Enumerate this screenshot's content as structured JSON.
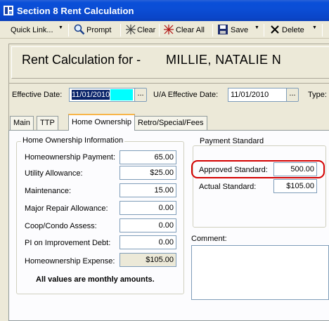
{
  "window": {
    "title": "Section 8 Rent Calculation",
    "icon": "app-icon"
  },
  "toolbar": {
    "quick_link": "Quick Link...",
    "prompt": "Prompt",
    "clear": "Clear",
    "clear_all": "Clear All",
    "save": "Save",
    "delete": "Delete"
  },
  "header": {
    "label": "Rent Calculation for  -",
    "tenant_name": "MILLIE, NATALIE N"
  },
  "dates": {
    "effective_label": "Effective Date:",
    "effective_value": "11/01/2010",
    "ua_label": "U/A Effective Date:",
    "ua_value": "11/01/2010",
    "type_label": "Type:",
    "browse": "..."
  },
  "tabs": [
    {
      "label": "Main"
    },
    {
      "label": "TTP"
    },
    {
      "label": "Home Ownership"
    },
    {
      "label": "Retro/Special/Fees"
    }
  ],
  "home_ownership": {
    "group_title": "Home Ownership Information",
    "rows": [
      {
        "label": "Homeownership Payment:",
        "value": "65.00"
      },
      {
        "label": "Utility Allowance:",
        "value": "$25.00"
      },
      {
        "label": "Maintenance:",
        "value": "15.00"
      },
      {
        "label": "Major Repair Allowance:",
        "value": "0.00"
      },
      {
        "label": "Coop/Condo Assess:",
        "value": "0.00"
      },
      {
        "label": "PI on Improvement Debt:",
        "value": "0.00"
      },
      {
        "label": "Homeownership Expense:",
        "value": "$105.00"
      }
    ],
    "note": "All values are monthly amounts."
  },
  "payment_standard": {
    "group_title": "Payment Standard",
    "approved_label": "Approved Standard:",
    "approved_value": "500.00",
    "actual_label": "Actual Standard:",
    "actual_value": "$105.00"
  },
  "comment": {
    "label": "Comment:",
    "value": ""
  },
  "colors": {
    "titlebar": "#0a4fd8",
    "highlight_ring": "#d40000",
    "active_tab_accent": "#f8b548"
  }
}
